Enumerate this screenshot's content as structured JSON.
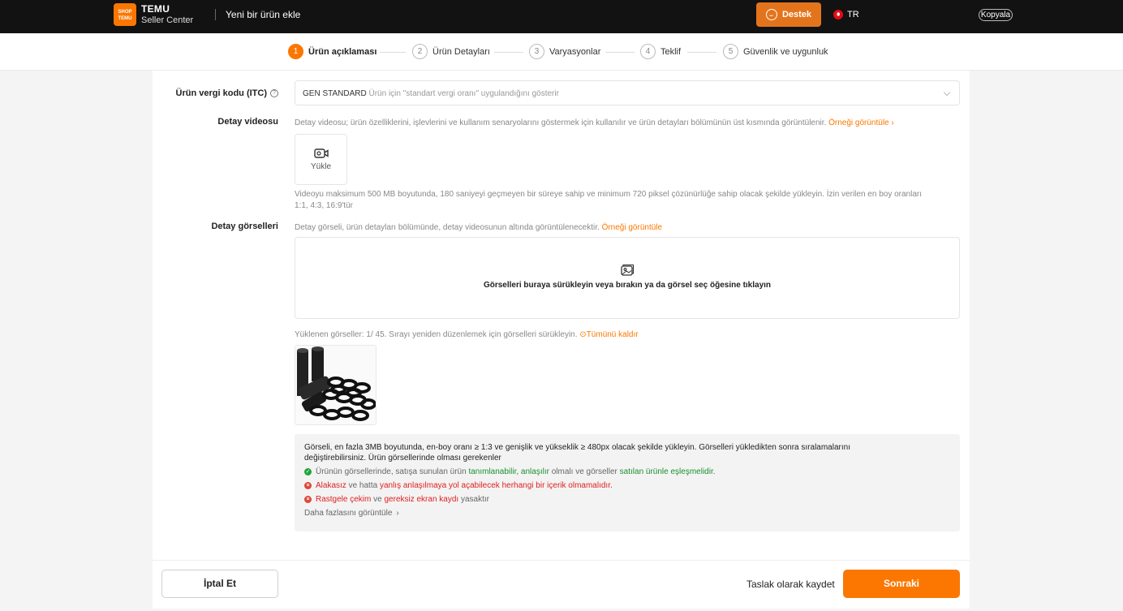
{
  "header": {
    "logo_text": "SHOP TEMU",
    "brand": "TEMU",
    "brand_sub": "Seller Center",
    "page_title": "Yeni bir ürün ekle",
    "support_label": "Destek",
    "language": "TR",
    "copy_label": "Kopyala"
  },
  "steps": [
    {
      "num": "1",
      "label": "Ürün açıklaması",
      "active": true
    },
    {
      "num": "2",
      "label": "Ürün Detayları",
      "active": false
    },
    {
      "num": "3",
      "label": "Varyasyonlar",
      "active": false
    },
    {
      "num": "4",
      "label": "Teklif",
      "active": false
    },
    {
      "num": "5",
      "label": "Güvenlik ve uygunluk",
      "active": false
    }
  ],
  "tax_code": {
    "label": "Ürün vergi kodu (ITC)",
    "help": "?",
    "value": "GEN STANDARD",
    "value_desc": "Ürün için \"standart vergi oranı\" uygulandığını gösterir"
  },
  "detail_video": {
    "label": "Detay videosu",
    "hint": "Detay videosu; ürün özelliklerini, işlevlerini ve kullanım senaryolarını göstermek için kullanılır ve ürün detayları bölümünün üst kısmında görüntülenir.",
    "example_link": "Örneği görüntüle",
    "upload_label": "Yükle",
    "requirements_1": "Videoyu maksimum 500 MB boyutunda, 180 saniyeyi geçmeyen bir süreye sahip ve minimum 720 piksel çözünürlüğe sahip olacak şekilde yükleyin. İzin verilen en boy oranları",
    "requirements_2": "1:1, 4:3, 16:9'tür"
  },
  "detail_images": {
    "label": "Detay görselleri",
    "hint": "Detay görseli, ürün detayları bölümünde, detay videosunun altında görüntülenecektir.",
    "example_link": "Örneği görüntüle",
    "dropzone_text": "Görselleri buraya sürükleyin veya bırakın ya da görsel seç öğesine tıklayın",
    "uploaded_text": "Yüklenen görseller: 1/ 45. Sırayı yeniden düzenlemek için görselleri sürükleyin.",
    "remove_all": "Tümünü kaldır"
  },
  "guidelines": {
    "intro_1": "Görseli, en fazla 3MB boyutunda, en-boy oranı ≥ 1:3 ve genişlik ve yükseklik ≥ 480px olacak şekilde yükleyin. Görselleri yükledikten sonra sıralamalarını",
    "intro_2": "değiştirebilirsiniz. Ürün görsellerinde olması gerekenler",
    "r1_a": "Ürünün görsellerinde, satışa sunulan ürün",
    "r1_b": "tanımlanabilir, anlaşılır",
    "r1_c": "olmalı ve görseller",
    "r1_d": "satılan ürünle eşleşmelidir.",
    "r2_a": "Alakasız",
    "r2_b": "ve hatta",
    "r2_c": "yanlış anlaşılmaya yol açabilecek herhangi bir içerik olmamalıdır.",
    "r3_a": "Rastgele çekim",
    "r3_b": "ve",
    "r3_c": "gereksiz ekran kaydı",
    "r3_d": "yasaktır",
    "more_link": "Daha fazlasını görüntüle"
  },
  "footer": {
    "cancel_label": "İptal Et",
    "draft_label": "Taslak olarak kaydet",
    "next_label": "Sonraki"
  },
  "colors": {
    "accent": "#fb7701",
    "topbar": "#121212",
    "success": "#1fa53a",
    "error": "#e0453a"
  }
}
